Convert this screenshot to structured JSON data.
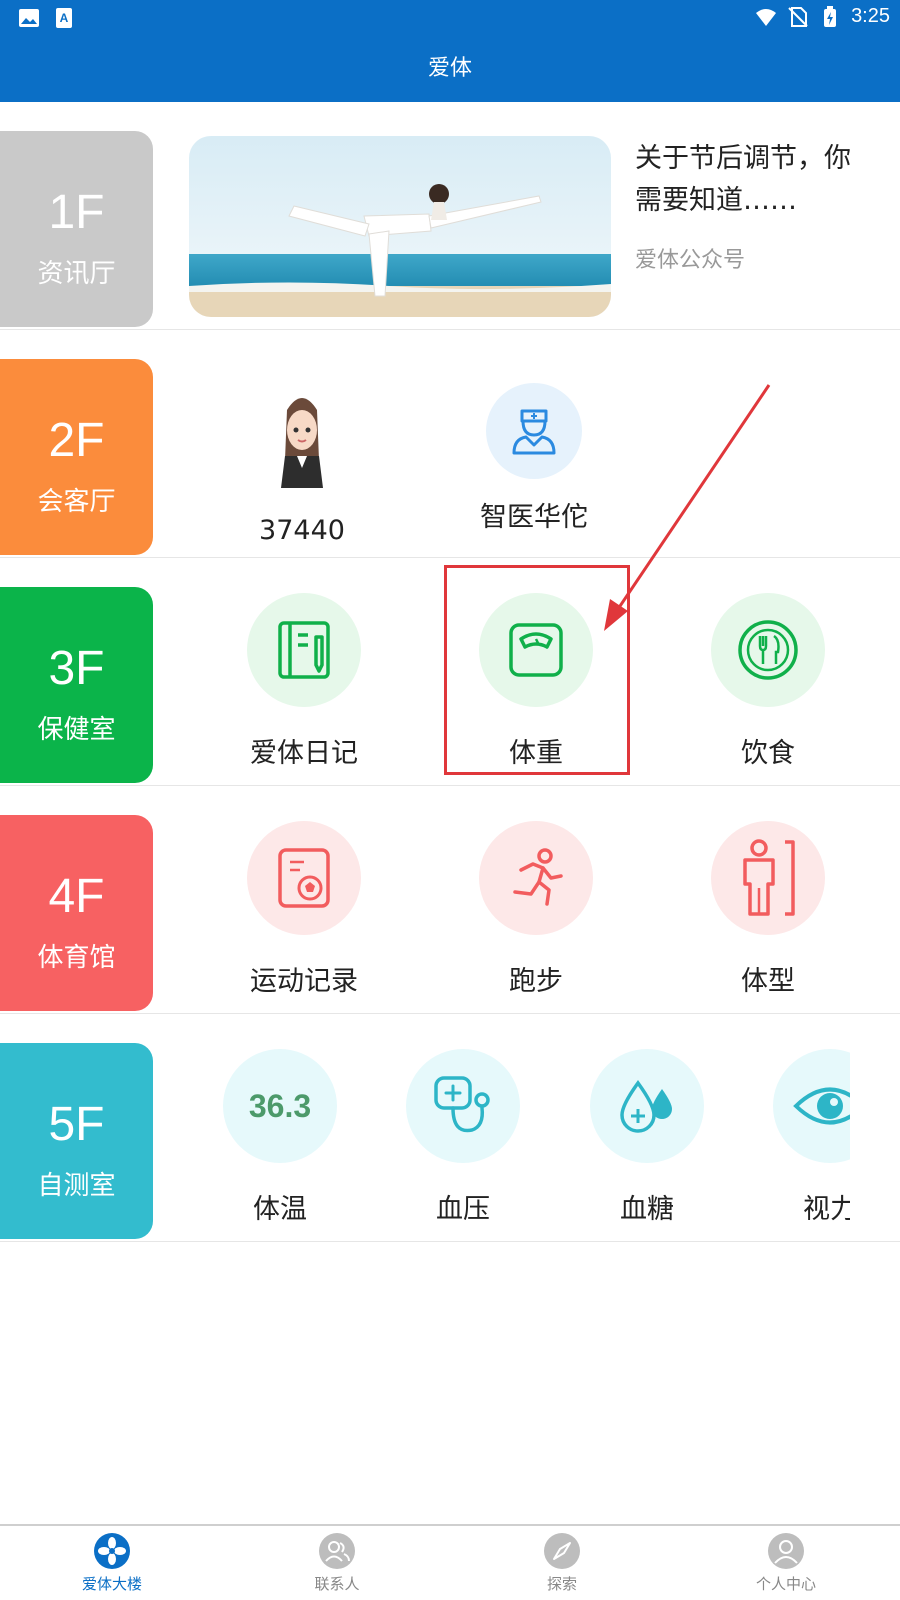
{
  "status_bar": {
    "time": "3:25",
    "left_icons": [
      "image-icon",
      "keyboard-a-icon"
    ],
    "right_icons": [
      "wifi-icon",
      "no-sim-icon",
      "battery-charging-icon"
    ]
  },
  "header": {
    "title": "爱体"
  },
  "floors": {
    "f1": {
      "num": "1F",
      "name": "资讯厅",
      "color": "#c9c9c9",
      "news": {
        "title": "关于节后调节，你需要知道……",
        "source": "爱体公众号",
        "image": "yoga-beach-image"
      }
    },
    "f2": {
      "num": "2F",
      "name": "会客厅",
      "color": "#fb8c3c",
      "items": [
        {
          "label": "37440",
          "icon": "avatar-icon"
        },
        {
          "label": "智医华佗",
          "icon": "doctor-icon"
        }
      ]
    },
    "f3": {
      "num": "3F",
      "name": "保健室",
      "color": "#0bb44a",
      "items": [
        {
          "label": "爱体日记",
          "icon": "diary-icon"
        },
        {
          "label": "体重",
          "icon": "scale-icon"
        },
        {
          "label": "饮食",
          "icon": "cutlery-icon"
        }
      ]
    },
    "f4": {
      "num": "4F",
      "name": "体育馆",
      "color": "#f76162",
      "items": [
        {
          "label": "运动记录",
          "icon": "sport-record-icon"
        },
        {
          "label": "跑步",
          "icon": "running-icon"
        },
        {
          "label": "体型",
          "icon": "body-shape-icon"
        }
      ]
    },
    "f5": {
      "num": "5F",
      "name": "自测室",
      "color": "#33bcce",
      "items": [
        {
          "label": "体温",
          "icon": "thermometer-icon",
          "value": "36.3"
        },
        {
          "label": "血压",
          "icon": "blood-pressure-icon"
        },
        {
          "label": "血糖",
          "icon": "blood-sugar-icon"
        },
        {
          "label": "视力",
          "icon": "eye-icon"
        }
      ]
    }
  },
  "tab_bar": {
    "tabs": [
      {
        "label": "爱体大楼",
        "icon": "building-icon",
        "active": true
      },
      {
        "label": "联系人",
        "icon": "contacts-icon",
        "active": false
      },
      {
        "label": "探索",
        "icon": "compass-icon",
        "active": false
      },
      {
        "label": "个人中心",
        "icon": "profile-icon",
        "active": false
      }
    ]
  },
  "annotation": {
    "highlight_target": "体重",
    "color": "#e0373b"
  }
}
